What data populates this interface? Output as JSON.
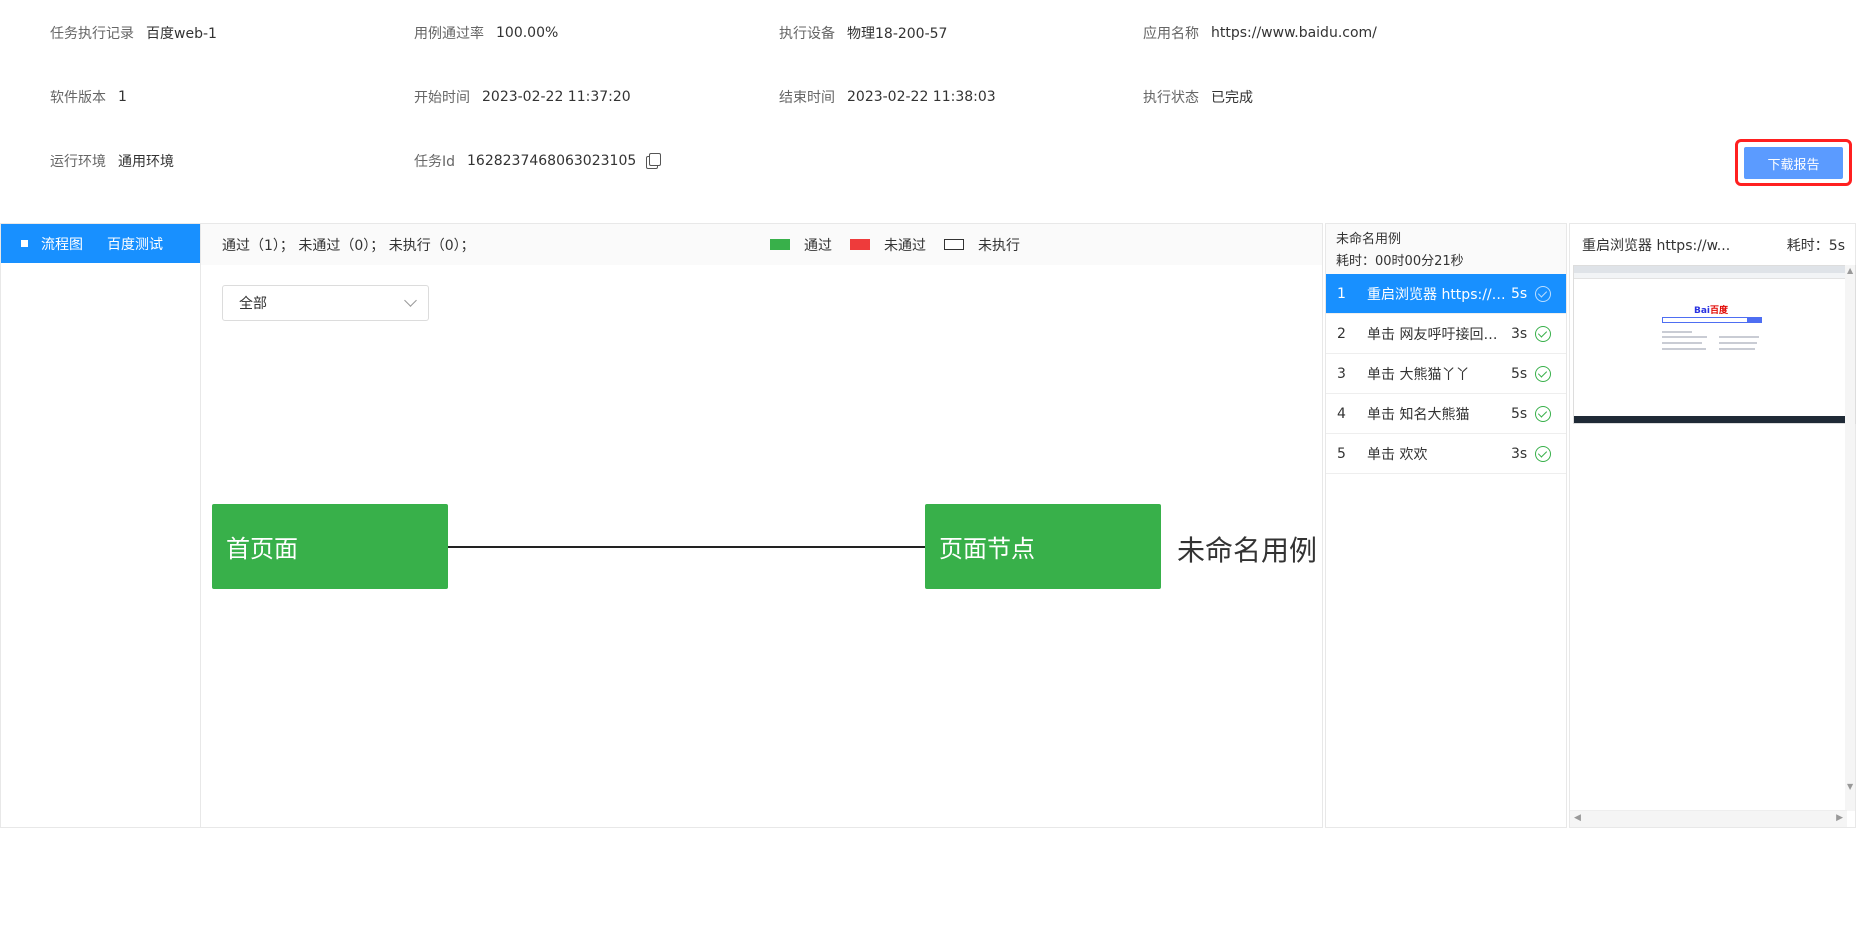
{
  "info": {
    "record": {
      "label": "任务执行记录",
      "value": "百度web-1"
    },
    "pass_rate": {
      "label": "用例通过率",
      "value": "100.00%"
    },
    "device": {
      "label": "执行设备",
      "value": "物理18-200-57"
    },
    "app_name": {
      "label": "应用名称",
      "value": "https://www.baidu.com/"
    },
    "software_version": {
      "label": "软件版本",
      "value": "1"
    },
    "start_time": {
      "label": "开始时间",
      "value": "2023-02-22 11:37:20"
    },
    "end_time": {
      "label": "结束时间",
      "value": "2023-02-22 11:38:03"
    },
    "status": {
      "label": "执行状态",
      "value": "已完成"
    },
    "environment": {
      "label": "运行环境",
      "value": "通用环境"
    },
    "task_id": {
      "label": "任务Id",
      "value": "1628237468063023105"
    }
  },
  "download_button": "下载报告",
  "left_tab": {
    "type": "流程图",
    "name": "百度测试"
  },
  "summary": "通过（1）； 未通过（0）； 未执行（0）；",
  "legend": {
    "pass": "通过",
    "fail": "未通过",
    "not_run": "未执行"
  },
  "filter": {
    "selected": "全部"
  },
  "flow": {
    "node1": "首页面",
    "node2": "页面节点",
    "tail": "未命名用例"
  },
  "case_panel": {
    "title": "未命名用例",
    "duration": "耗时：00时00分21秒",
    "steps": [
      {
        "idx": "1",
        "title": "重启浏览器 https://www.baidu.com/",
        "dur": "5s",
        "active": true
      },
      {
        "idx": "2",
        "title": "单击 网友呼吁接回旅日大熊猫",
        "dur": "3s",
        "active": false
      },
      {
        "idx": "3",
        "title": "单击 大熊猫丫丫",
        "dur": "5s",
        "active": false
      },
      {
        "idx": "4",
        "title": "单击 知名大熊猫",
        "dur": "5s",
        "active": false
      },
      {
        "idx": "5",
        "title": "单击 欢欢",
        "dur": "3s",
        "active": false
      }
    ]
  },
  "shot_panel": {
    "title": "重启浏览器 https://w...",
    "time": "耗时：5s",
    "logo_left": "Bai",
    "logo_right": "百度"
  },
  "colors": {
    "pass": "#38b04a",
    "fail": "#ee3b3b",
    "accent": "#1890ff",
    "download": "#5b9bff"
  }
}
